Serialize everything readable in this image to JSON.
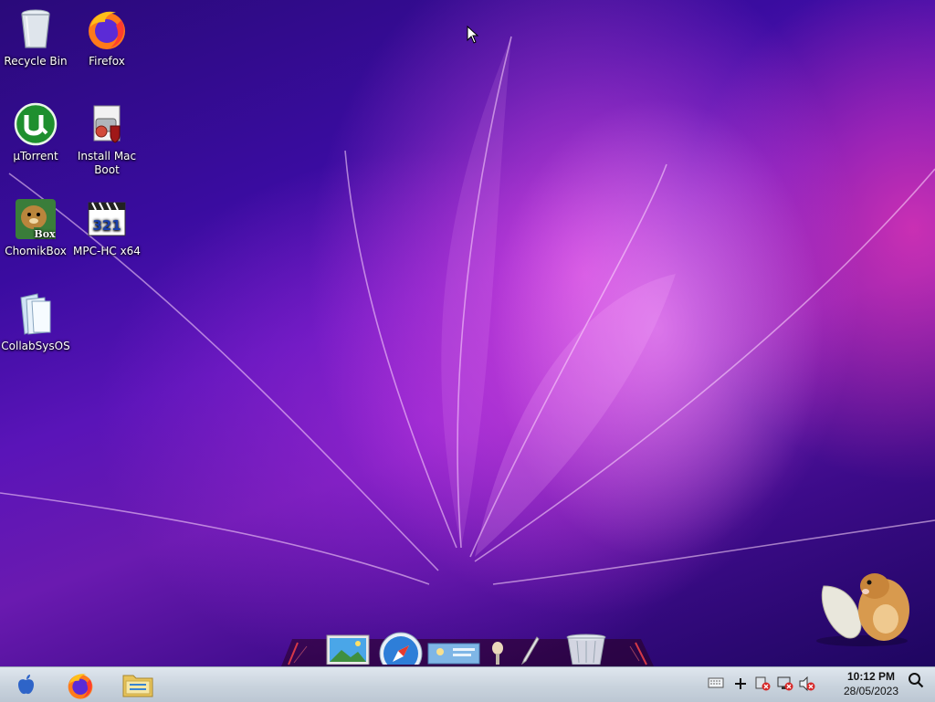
{
  "desktop": {
    "icons": [
      {
        "label": "Recycle Bin",
        "icon": "recycle-bin-icon"
      },
      {
        "label": "Firefox",
        "icon": "firefox-icon"
      },
      {
        "label": "µTorrent",
        "icon": "utorrent-icon"
      },
      {
        "label": "Install Mac Boot",
        "icon": "installer-icon"
      },
      {
        "label": "ChomikBox",
        "icon": "chomikbox-icon"
      },
      {
        "label": "MPC-HC x64",
        "icon": "mpc-hc-icon"
      },
      {
        "label": "CollabSysOS",
        "icon": "folder-icon"
      }
    ],
    "chomikbox_badge": "Box",
    "mpc_badge": "321"
  },
  "dock": {
    "items": [
      "photos-icon",
      "safari-icon",
      "mail-icon",
      "lamp-icon",
      "pen-icon",
      "trash-icon"
    ]
  },
  "taskbar": {
    "start_icon": "apple-icon",
    "pinned": [
      "firefox-icon",
      "file-explorer-icon"
    ],
    "tray": [
      "keyboard-icon",
      "plus-icon",
      "flag-error-icon",
      "network-error-icon",
      "volume-muted-icon"
    ],
    "clock": {
      "time": "10:12 PM",
      "date": "28/05/2023"
    },
    "search_icon": "search-icon"
  },
  "colors": {
    "wallpaper_dark": "#2a0a7a",
    "wallpaper_magenta": "#ec50e6",
    "taskbar": "#c9d3dd"
  }
}
